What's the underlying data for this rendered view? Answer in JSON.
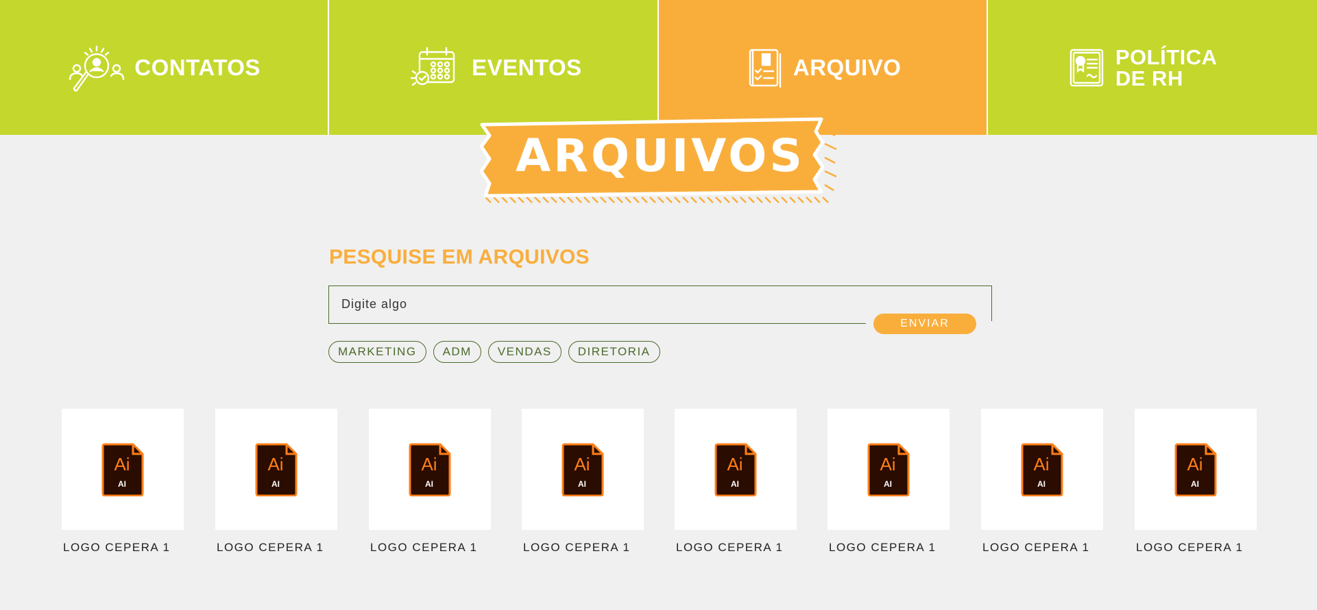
{
  "nav": {
    "items": [
      {
        "label": "CONTATOS",
        "icon": "contacts-search-icon",
        "active": false
      },
      {
        "label": "EVENTOS",
        "icon": "calendar-icon",
        "active": false
      },
      {
        "label": "ARQUIVO",
        "icon": "document-checklist-icon",
        "active": true
      },
      {
        "label_line1": "POLÍTICA",
        "label_line2": "DE RH",
        "icon": "certificate-icon",
        "active": false
      }
    ]
  },
  "banner": {
    "title": "ARQUIVOS"
  },
  "search": {
    "heading": "PESQUISE EM ARQUIVOS",
    "placeholder": "Digite algo",
    "submit_label": "ENVIAR"
  },
  "filters": [
    "MARKETING",
    "ADM",
    "VENDAS",
    "DIRETORIA"
  ],
  "files": [
    {
      "name": "LOGO CEPERA 1",
      "icon_text": "Ai",
      "icon_subtext": "AI"
    },
    {
      "name": "LOGO CEPERA 1",
      "icon_text": "Ai",
      "icon_subtext": "AI"
    },
    {
      "name": "LOGO CEPERA 1",
      "icon_text": "Ai",
      "icon_subtext": "AI"
    },
    {
      "name": "LOGO CEPERA 1",
      "icon_text": "Ai",
      "icon_subtext": "AI"
    },
    {
      "name": "LOGO CEPERA 1",
      "icon_text": "Ai",
      "icon_subtext": "AI"
    },
    {
      "name": "LOGO CEPERA 1",
      "icon_text": "Ai",
      "icon_subtext": "AI"
    },
    {
      "name": "LOGO CEPERA 1",
      "icon_text": "Ai",
      "icon_subtext": "AI"
    },
    {
      "name": "LOGO CEPERA 1",
      "icon_text": "Ai",
      "icon_subtext": "AI"
    }
  ],
  "colors": {
    "nav_green": "#c4d72d",
    "accent_orange": "#f9ae3c",
    "background": "#f0f0f0",
    "border_green": "#4a6a2a",
    "ai_dark": "#2a0c00",
    "ai_orange": "#ff7f18"
  }
}
